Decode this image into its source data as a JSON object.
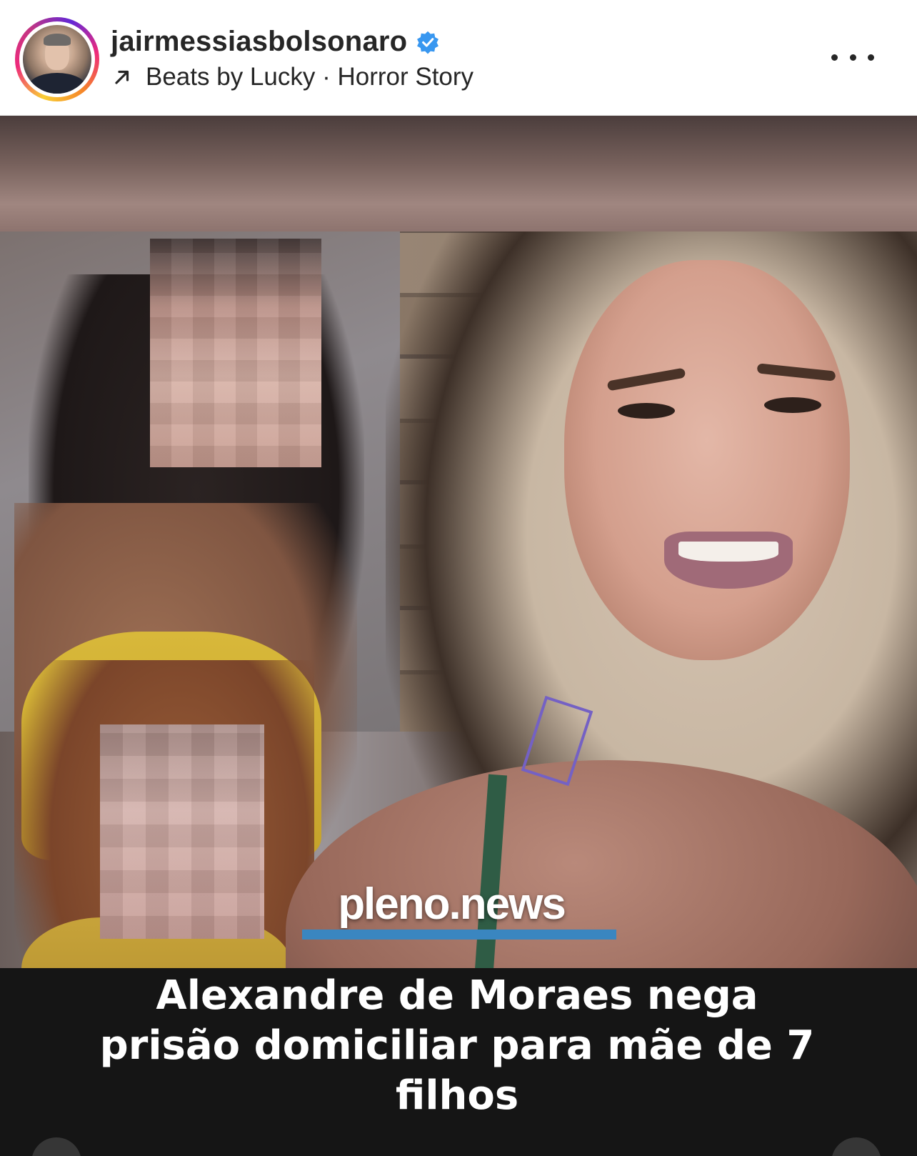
{
  "post": {
    "username": "jairmessiasbolsonaro",
    "verified": true,
    "audio_artist": "Beats by Lucky",
    "audio_separator": " · ",
    "audio_track": "Horror Story",
    "icons": {
      "avatar": "profile-avatar",
      "verified": "verified-badge-icon",
      "audio": "arrow-up-right-icon",
      "more": "more-options-icon"
    }
  },
  "media": {
    "logo_text": "pleno.news",
    "headline": "Alexandre de Moraes nega prisão domiciliar para mãe de 7 filhos"
  },
  "colors": {
    "verified_blue": "#3897f0",
    "logo_bar": "#3a86c0",
    "text_primary": "#262626",
    "headline_bg": "#151515"
  }
}
